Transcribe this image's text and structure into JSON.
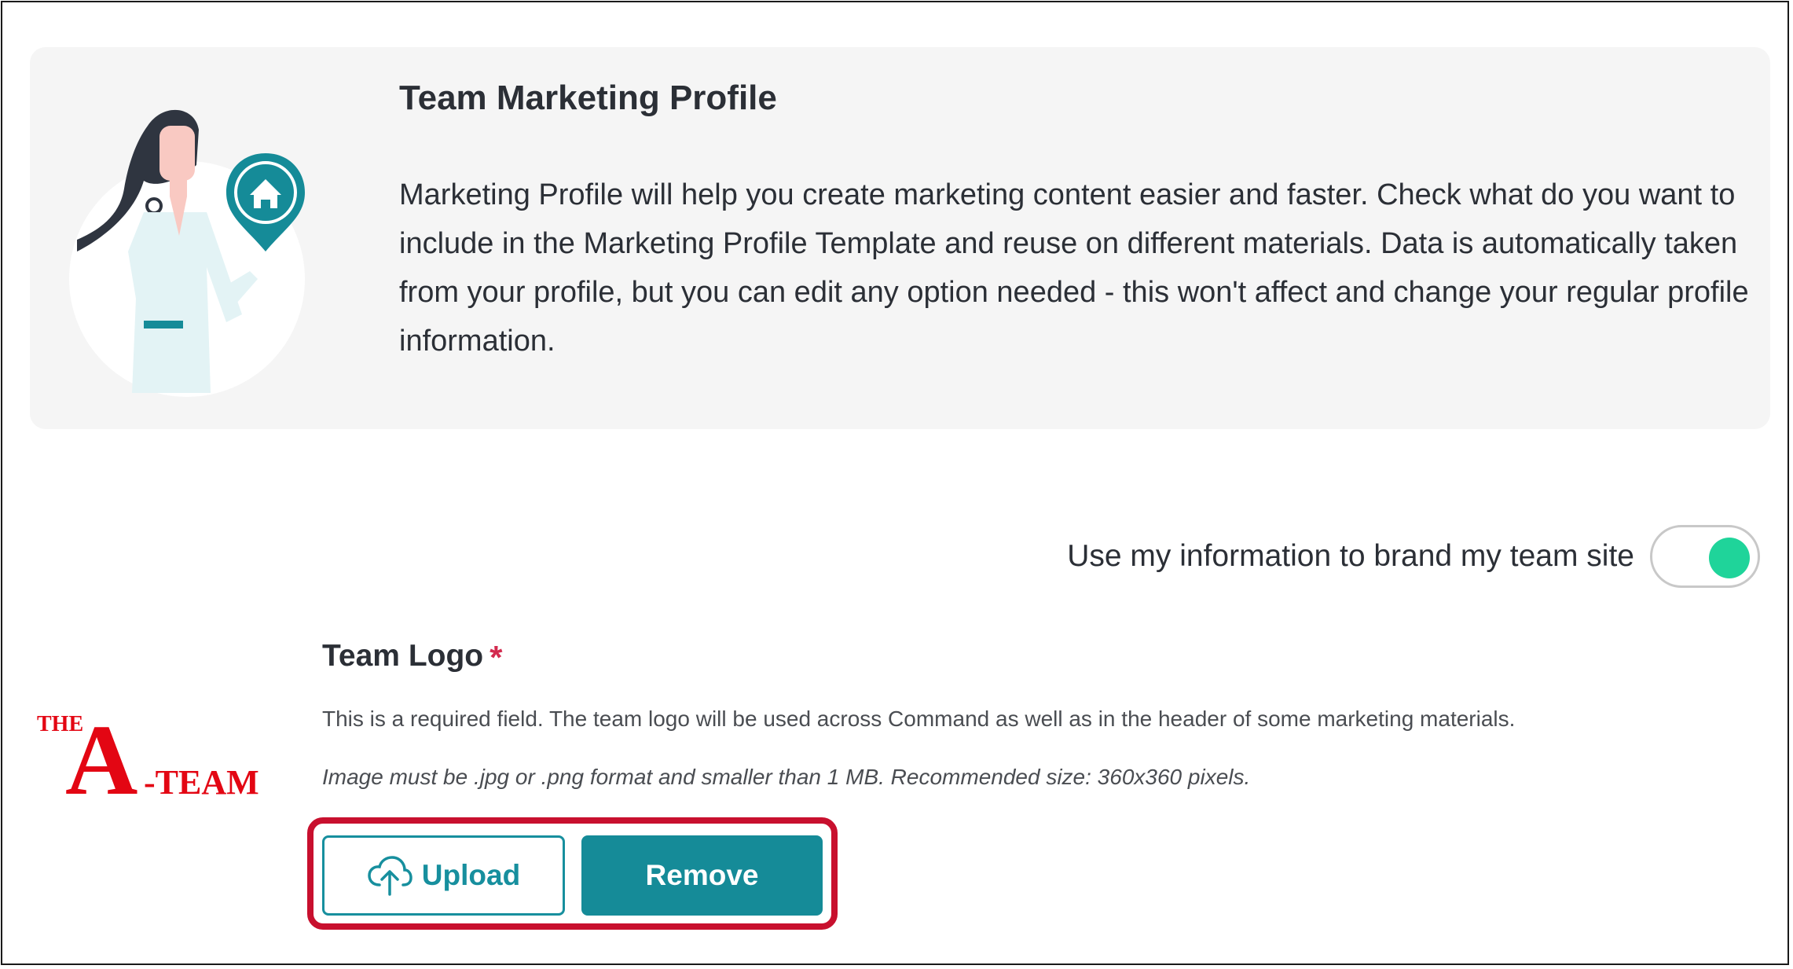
{
  "intro": {
    "title": "Team Marketing Profile",
    "description": "Marketing Profile will help you create marketing content easier and faster. Check what do you want to include in the Marketing Profile Template and reuse on different materials. Data is automatically taken from your profile, but you can edit any option needed - this won't affect and change your regular profile information."
  },
  "branding": {
    "toggle_label": "Use my information to brand my team site",
    "toggle_on": true
  },
  "team_logo": {
    "title": "Team Logo",
    "required_mark": "*",
    "description": "This is a required field. The team logo will be used across Command as well as in the header of some marketing materials.",
    "format_note": "Image must be .jpg or .png format and smaller than 1 MB. Recommended size: 360x360 pixels.",
    "logo_text": {
      "the": "THE",
      "a": "A",
      "team": "-TEAM"
    },
    "upload_label": "Upload",
    "remove_label": "Remove"
  },
  "colors": {
    "accent": "#158b98",
    "toggle_on": "#1fd49a",
    "highlight": "#c8102e",
    "required": "#d32b4f",
    "logo_red": "#e30613"
  },
  "icons": [
    "person-with-house-pin-illustration",
    "cloud-upload-icon"
  ]
}
